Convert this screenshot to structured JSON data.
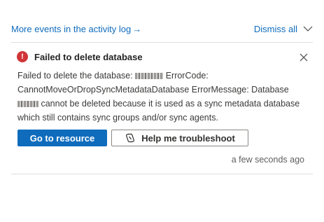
{
  "topbar": {
    "activity_link": "More events in the activity log",
    "activity_arrow": "→",
    "dismiss_label": "Dismiss all"
  },
  "notification": {
    "title": "Failed to delete database",
    "error_icon": "error-circle-icon",
    "message": {
      "part1": "Failed to delete the database:",
      "part2": "ErrorCode: CannotMoveOrDropSyncMetadataDatabase ErrorMessage: Database",
      "part3": "cannot be deleted because it is used as a sync metadata database which still contains sync groups and/or sync agents."
    },
    "primary_button": "Go to resource",
    "secondary_button": "Help me troubleshoot",
    "timestamp": "a few seconds ago"
  },
  "colors": {
    "accent": "#0f6cbd",
    "error": "#d13438"
  }
}
